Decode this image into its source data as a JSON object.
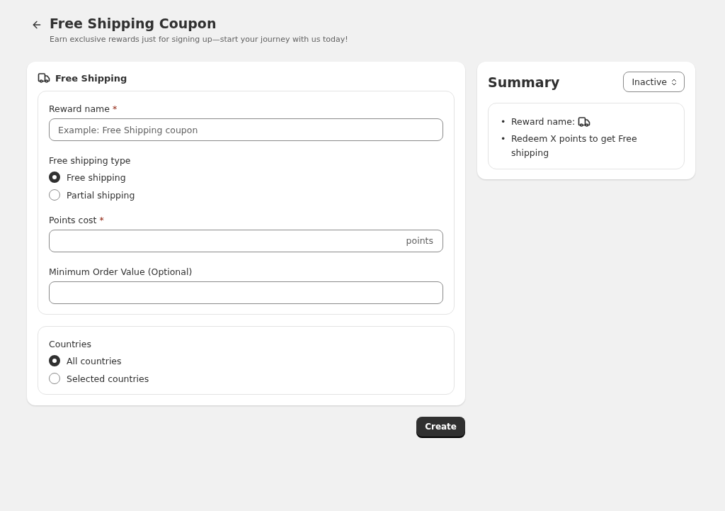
{
  "header": {
    "title": "Free Shipping Coupon",
    "subtitle": "Earn exclusive rewards just for signing up—start your journey with us today!"
  },
  "form": {
    "title": "Free Shipping",
    "sections": [
      {
        "fields": [
          {
            "kind": "text",
            "label": "Reward name",
            "required_mark": "*",
            "placeholder": "Example: Free Shipping coupon"
          },
          {
            "kind": "radio",
            "label": "Free shipping type",
            "options": [
              {
                "label": "Free shipping",
                "selected": true
              },
              {
                "label": "Partial shipping",
                "selected": false
              }
            ]
          },
          {
            "kind": "text",
            "label": "Points cost",
            "required_mark": "*",
            "suffix": "points"
          },
          {
            "kind": "text",
            "label": "Minimum Order Value (Optional)"
          }
        ]
      },
      {
        "fields": [
          {
            "kind": "radio",
            "label": "Countries",
            "options": [
              {
                "label": "All countries",
                "selected": true
              },
              {
                "label": "Selected countries",
                "selected": false
              }
            ]
          }
        ]
      }
    ]
  },
  "summary": {
    "title": "Summary",
    "status": "Inactive",
    "items": [
      {
        "kind": "with_icon",
        "bullet": "•",
        "text": "Reward name:"
      },
      {
        "kind": "plain",
        "bullet": "•",
        "text": "Redeem X points to get Free shipping"
      }
    ]
  },
  "actions": {
    "primary": "Create"
  }
}
